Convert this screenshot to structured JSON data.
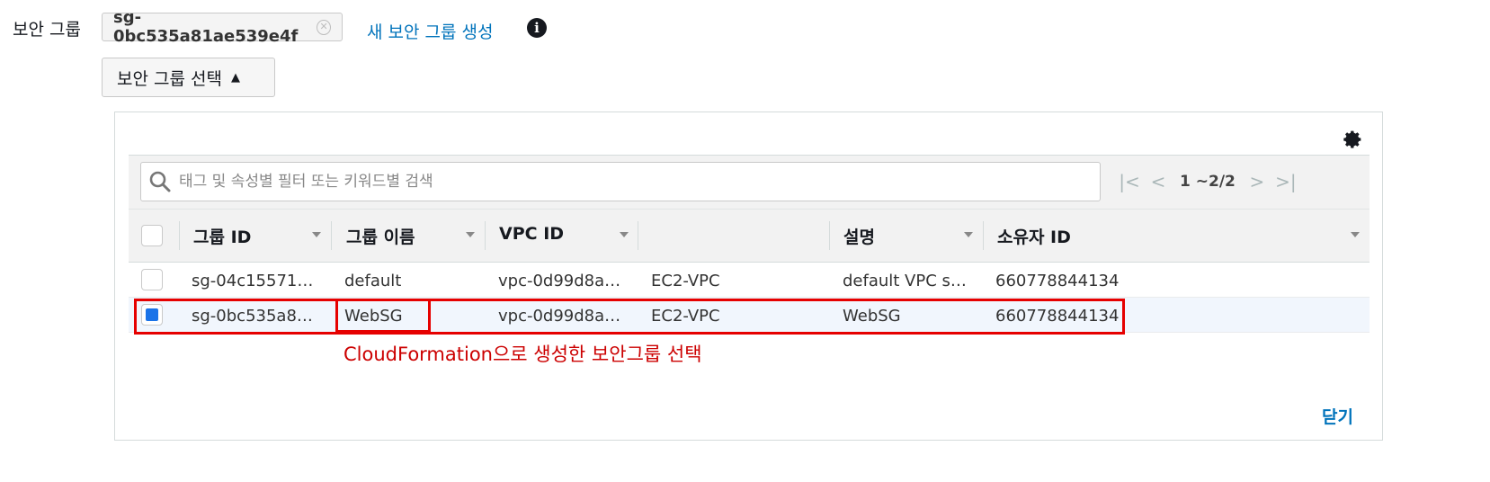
{
  "field": {
    "label": "보안 그룹",
    "selected_tag": "sg-0bc535a81ae539e4f",
    "create_link": "새 보안 그룹 생성"
  },
  "select_button": {
    "label": "보안 그룹 선택"
  },
  "search": {
    "placeholder": "태그 및 속성별 필터 또는 키워드별 검색",
    "value": ""
  },
  "pagination": {
    "range": "1 ~2/2"
  },
  "table": {
    "columns": [
      "그룹 ID",
      "그룹 이름",
      "VPC ID",
      "",
      "설명",
      "소유자 ID"
    ],
    "rows": [
      {
        "selected": false,
        "cells": [
          "sg-04c15571…",
          "default",
          "vpc-0d99d8a…",
          "EC2-VPC",
          "default VPC s…",
          "660778844134"
        ]
      },
      {
        "selected": true,
        "cells": [
          "sg-0bc535a8…",
          "WebSG",
          "vpc-0d99d8a…",
          "EC2-VPC",
          "WebSG",
          "660778844134"
        ]
      }
    ]
  },
  "annotation": "CloudFormation으로 생성한 보안그룹 선택",
  "close_link": "닫기",
  "colors": {
    "link": "#0073bb",
    "highlight": "#e60000",
    "annotation": "#cc0000",
    "checkbox": "#1a73e8"
  }
}
